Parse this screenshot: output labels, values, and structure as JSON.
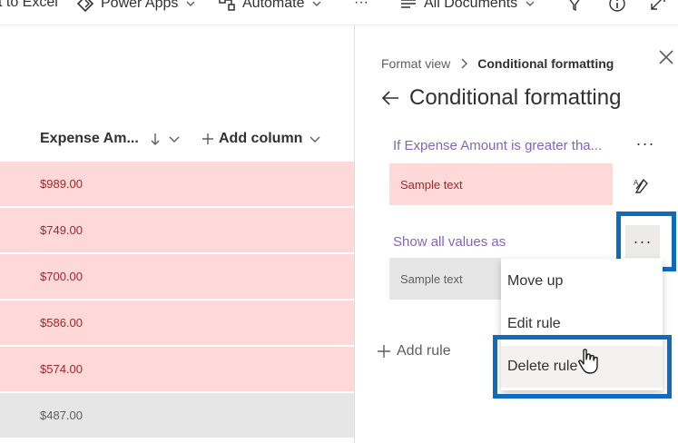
{
  "command_bar": {
    "export_label": "t to Excel",
    "power_apps_label": "Power Apps",
    "automate_label": "Automate",
    "more_label": "···",
    "view_label": "All Documents"
  },
  "list": {
    "column_header": "Expense Am...",
    "add_column_label": "Add column",
    "rows": [
      {
        "value": "$989.00",
        "state": "pink"
      },
      {
        "value": "$749.00",
        "state": "pink"
      },
      {
        "value": "$700.00",
        "state": "pink"
      },
      {
        "value": "$586.00",
        "state": "pink"
      },
      {
        "value": "$574.00",
        "state": "pink"
      },
      {
        "value": "$487.00",
        "state": "gray"
      }
    ]
  },
  "panel": {
    "breadcrumb_parent": "Format view",
    "breadcrumb_current": "Conditional formatting",
    "title": "Conditional formatting",
    "rule1_label": "If Expense Amount is greater tha...",
    "rule1_sample": "Sample text",
    "rule2_label": "Show all values as",
    "rule2_sample": "Sample text",
    "more_label": "···",
    "add_rule_label": "Add rule"
  },
  "context_menu": {
    "items": [
      "Move up",
      "Edit rule",
      "Delete rule"
    ],
    "hovered_index": 2
  },
  "colors": {
    "highlight": "#0f6cbd",
    "rule_text": "#8764b8",
    "pink_fill": "#fed9d8",
    "pink_text": "#a4262c",
    "gray_fill": "#e6e6e6"
  }
}
